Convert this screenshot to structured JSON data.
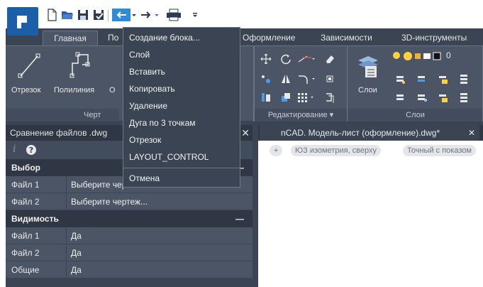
{
  "quick_access": {
    "icons": [
      "new-file-icon",
      "open-folder-icon",
      "save-icon",
      "save-as-icon",
      "undo-icon",
      "dropdown-arrow-icon",
      "redo-icon",
      "dropdown-arrow-icon",
      "print-icon",
      "customize-icon"
    ]
  },
  "ribbon_tabs": [
    {
      "label": "Главная",
      "active": true
    },
    {
      "label": "По"
    },
    {
      "label": "Оформление"
    },
    {
      "label": "Зависимости"
    },
    {
      "label": "3D-инструменты"
    }
  ],
  "draw_group": {
    "buttons": [
      {
        "label": "Отрезок",
        "icon": "line-icon"
      },
      {
        "label": "Полилиния",
        "icon": "polyline-icon"
      },
      {
        "label": "О"
      }
    ],
    "title": "Черт"
  },
  "edit_group": {
    "title": "Редактирование"
  },
  "layers_group": {
    "button_label": "Слои",
    "title": "Слои",
    "layer_value": "0"
  },
  "menu": {
    "items": [
      "Создание блока...",
      "Слой",
      "Вставить",
      "Копировать",
      "Удаление",
      "Дуга по 3 точкам",
      "Отрезок",
      "LAYOUT_CONTROL"
    ],
    "cancel": "Отмена"
  },
  "panel": {
    "title": "Сравнение файлов .dwg",
    "close": "✕",
    "sections": [
      {
        "title": "Выбор",
        "rows": [
          {
            "key": "Файл 1",
            "value": "Выберите чертеж..."
          },
          {
            "key": "Файл 2",
            "value": "Выберите чертеж..."
          }
        ]
      },
      {
        "title": "Видимость",
        "rows": [
          {
            "key": "Файл 1",
            "value": "Да"
          },
          {
            "key": "Файл 2",
            "value": "Да"
          },
          {
            "key": "Общие",
            "value": "Да"
          }
        ]
      }
    ]
  },
  "document": {
    "tab_title": "nCAD. Модель-лист (оформление).dwg*",
    "tab_close": "✕",
    "chips": [
      "+",
      "ЮЗ изометрия, сверху",
      "Точный с показом"
    ]
  },
  "colors": {
    "ribbon_bg": "#4b5566",
    "panel_bg": "#3b4453",
    "logo_blue": "#1c5fa8",
    "accent_blue": "#2f8ad8"
  }
}
